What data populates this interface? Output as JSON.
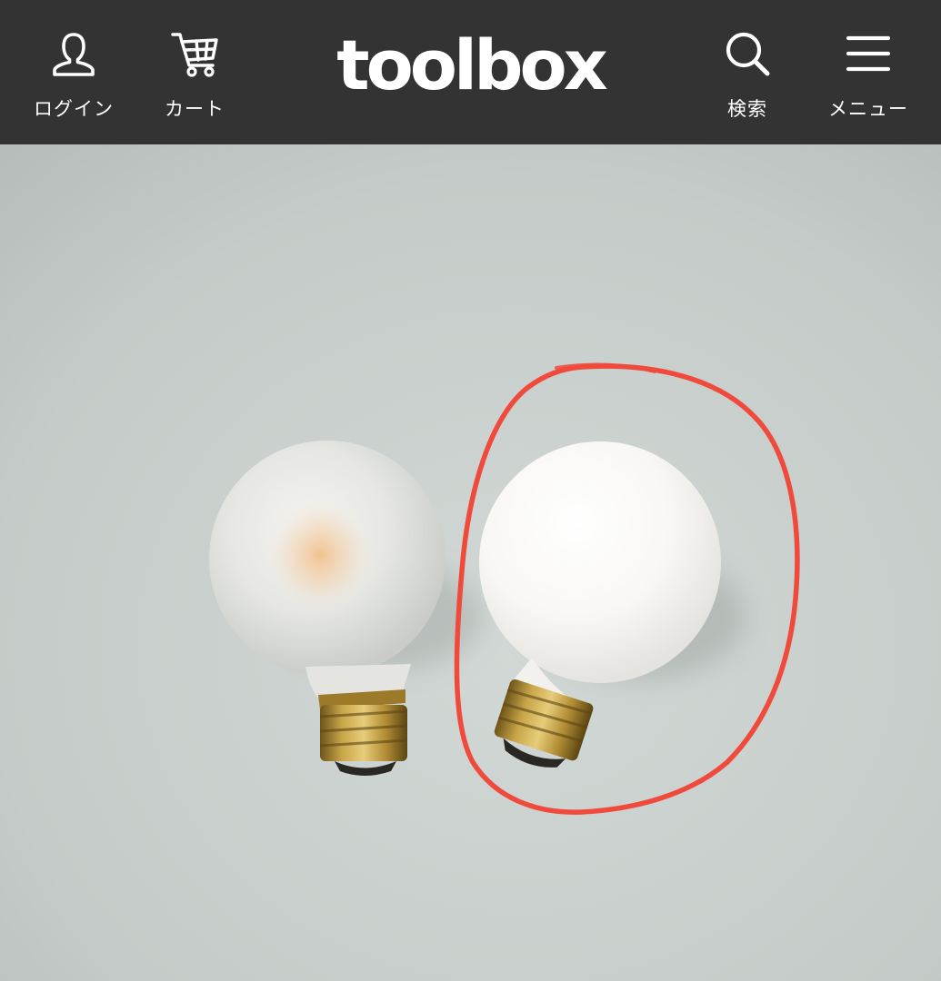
{
  "header": {
    "background": "#333333",
    "logo": "toolbox",
    "nav_left": [
      {
        "label": "ログイン",
        "icon": "user-icon"
      },
      {
        "label": "カート",
        "icon": "cart-icon"
      }
    ],
    "nav_right": [
      {
        "label": "検索",
        "icon": "search-icon"
      },
      {
        "label": "メニュー",
        "icon": "hamburger-menu-icon"
      }
    ]
  },
  "hero": {
    "image": "photo-of-two-globe-light-bulbs",
    "background_color": "#c9cfcc",
    "annotation_color": "#f04a3c"
  }
}
